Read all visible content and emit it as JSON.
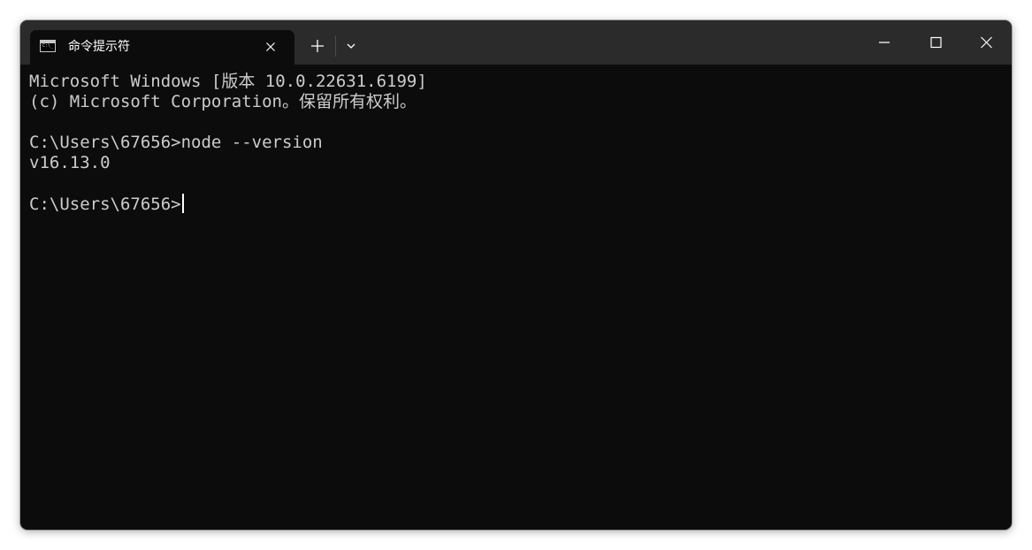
{
  "window": {
    "tab": {
      "title": "命令提示符",
      "icon": "command-prompt-icon",
      "icon_text": "C:\\_"
    },
    "controls": {
      "new_tab_icon": "plus-icon",
      "dropdown_icon": "chevron-down-icon",
      "minimize_icon": "minimize-icon",
      "maximize_icon": "maximize-icon",
      "close_icon": "close-icon"
    }
  },
  "terminal": {
    "lines": [
      "Microsoft Windows [版本 10.0.22631.6199]",
      "(c) Microsoft Corporation。保留所有权利。",
      "",
      "C:\\Users\\67656>node --version",
      "v16.13.0",
      ""
    ],
    "prompt": "C:\\Users\\67656>"
  },
  "colors": {
    "background": "#0c0c0c",
    "titlebar": "#2b2b2b",
    "text": "#cccccc"
  }
}
